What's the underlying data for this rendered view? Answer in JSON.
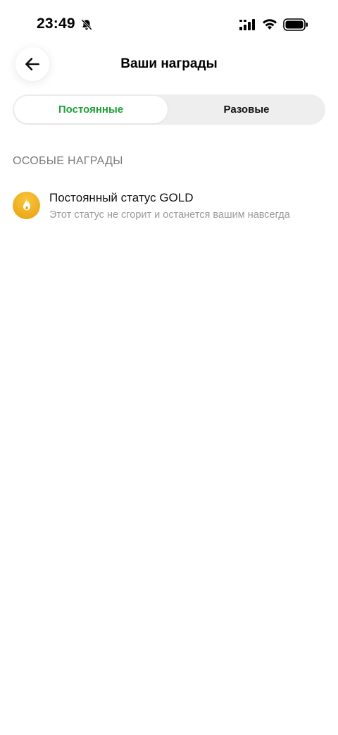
{
  "status_bar": {
    "time": "23:49",
    "icons": [
      "bell-slash-icon",
      "signal-icon",
      "wifi-icon",
      "battery-icon"
    ]
  },
  "header": {
    "title": "Ваши награды",
    "back_icon": "arrow-left-icon"
  },
  "tabs": [
    {
      "label": "Постоянные",
      "active": true
    },
    {
      "label": "Разовые",
      "active": false
    }
  ],
  "section": {
    "title": "ОСОБЫЕ НАГРАДЫ",
    "items": [
      {
        "icon": "flame-icon",
        "title": "Постоянный статус GOLD",
        "description": "Этот статус не сгорит и останется вашим навсегда"
      }
    ]
  },
  "colors": {
    "accent": "#21a038",
    "badge": "#eeaa1d",
    "muted": "#9a9a9a",
    "section_title": "#7a7a7a",
    "tab_bg": "#eeeeee"
  }
}
